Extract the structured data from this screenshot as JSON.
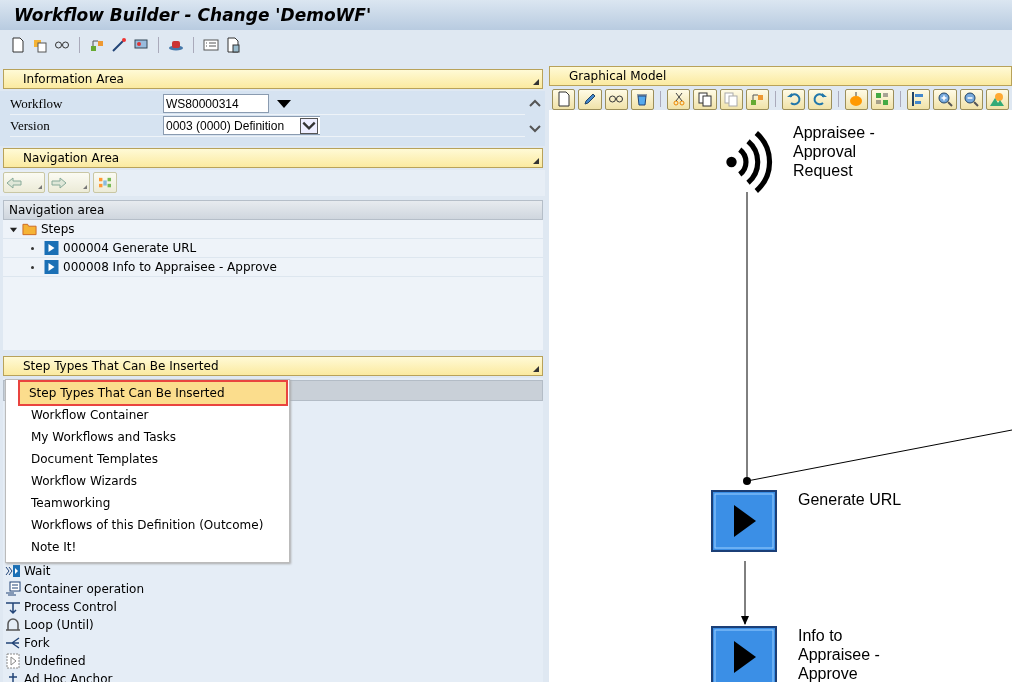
{
  "window": {
    "title": "Workflow Builder - Change 'DemoWF'"
  },
  "information_area": {
    "title": "Information Area",
    "fields": [
      {
        "label": "Workflow",
        "value": "WS80000314",
        "kind": "dropdown"
      },
      {
        "label": "Version",
        "value": "0003 (0000) Definition",
        "kind": "select"
      }
    ]
  },
  "navigation_area": {
    "title": "Navigation Area",
    "tree_header": "Navigation area",
    "tree": [
      {
        "label": "Steps",
        "expanded": true,
        "children": [
          {
            "label": "000004 Generate URL"
          },
          {
            "label": "000008 Info to Appraisee - Approve"
          }
        ]
      }
    ]
  },
  "step_types": {
    "title": "Step Types That Can Be Inserted",
    "menu": [
      {
        "label": "Step Types That Can Be Inserted",
        "selected": true
      },
      {
        "label": "Workflow Container",
        "selected": false
      },
      {
        "label": "My Workflows and Tasks",
        "selected": false
      },
      {
        "label": "Document Templates",
        "selected": false
      },
      {
        "label": "Workflow Wizards",
        "selected": false
      },
      {
        "label": "Teamworking",
        "selected": false
      },
      {
        "label": "Workflows of this Definition (Outcome)",
        "selected": false
      },
      {
        "label": "Note It!",
        "selected": false
      }
    ],
    "items": [
      {
        "label": "Wait",
        "kind": "wait"
      },
      {
        "label": "Container operation",
        "kind": "container"
      },
      {
        "label": "Process Control",
        "kind": "control"
      },
      {
        "label": "Loop (Until)",
        "kind": "loop"
      },
      {
        "label": "Fork",
        "kind": "fork"
      },
      {
        "label": "Undefined",
        "kind": "undefined"
      },
      {
        "label": "Ad Hoc Anchor",
        "kind": "anchor"
      }
    ]
  },
  "graphical_model": {
    "title": "Graphical Model",
    "nodes": [
      {
        "kind": "event",
        "label": "Appraisee - Approval Request"
      },
      {
        "kind": "step",
        "label": "Generate URL"
      },
      {
        "kind": "step",
        "label": "Info to Appraisee - Approve"
      }
    ]
  }
}
